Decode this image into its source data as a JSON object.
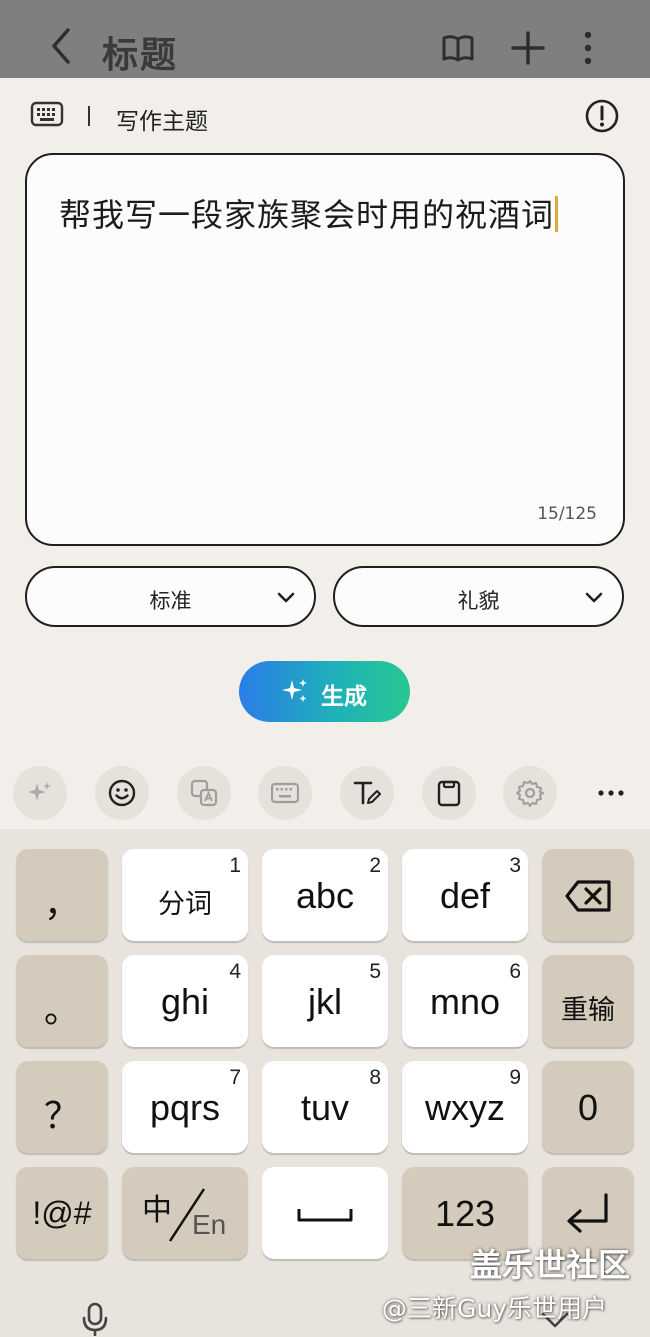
{
  "app_bar": {
    "title": "标题"
  },
  "writing_panel": {
    "header_label": "写作主题",
    "prompt_text": "帮我写一段家族聚会时用的祝酒词",
    "char_counter": "15/125",
    "style_select": {
      "selected": "标准"
    },
    "tone_select": {
      "selected": "礼貌"
    },
    "generate_label": "生成"
  },
  "toolbar": {
    "icons": [
      "ai-sparkle-icon",
      "emoji-icon",
      "translate-icon",
      "keyboard-icon",
      "text-edit-icon",
      "clipboard-icon",
      "settings-icon",
      "more-icon"
    ]
  },
  "keyboard": {
    "row1": {
      "comma": "，",
      "k1": "分词",
      "k1_num": "1",
      "k2": "abc",
      "k2_num": "2",
      "k3": "def",
      "k3_num": "3"
    },
    "row2": {
      "period": "。",
      "k4": "ghi",
      "k4_num": "4",
      "k5": "jkl",
      "k5_num": "5",
      "k6": "mno",
      "k6_num": "6",
      "retype": "重输"
    },
    "row3": {
      "question": "？",
      "k7": "pqrs",
      "k7_num": "7",
      "k8": "tuv",
      "k8_num": "8",
      "k9": "wxyz",
      "k9_num": "9",
      "zero": "0"
    },
    "row4": {
      "symbols": "!@#",
      "lang_cn": "中",
      "lang_en": "En",
      "numbers": "123"
    }
  },
  "watermark": {
    "line1": "盖乐世社区",
    "line2": "@三新Guy乐世用户"
  },
  "colors": {
    "accent_caret": "#e2a93a",
    "generate_gradient_start": "#2a7de8",
    "generate_gradient_end": "#27c890",
    "func_key": "#d4cbbd"
  }
}
